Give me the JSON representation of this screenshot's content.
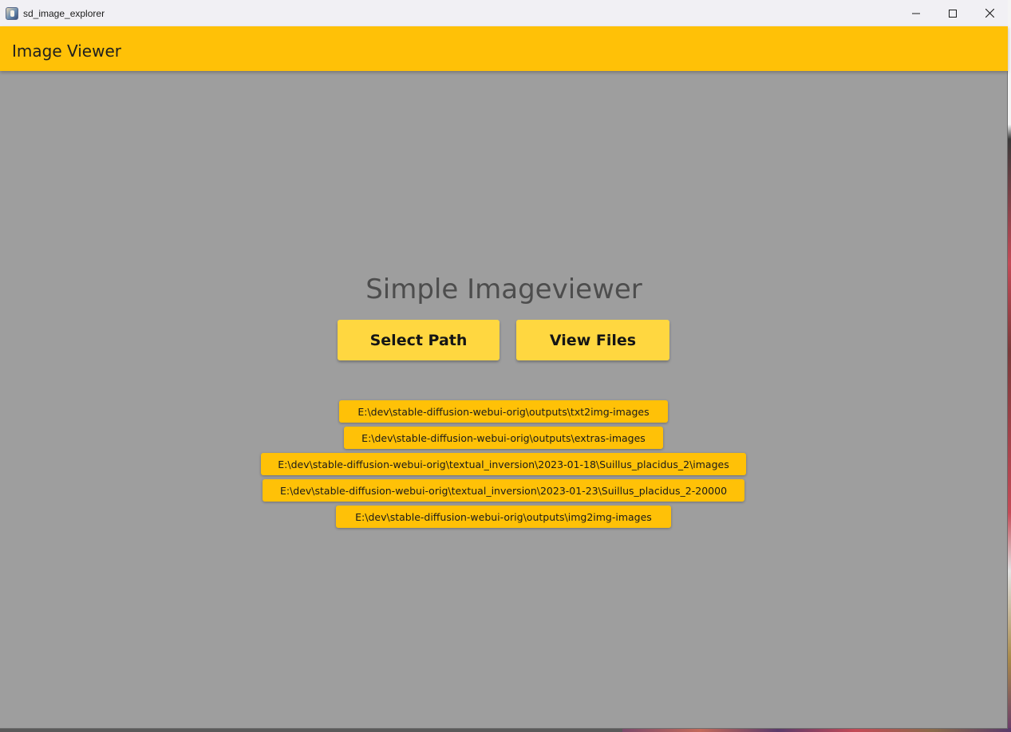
{
  "window": {
    "title": "sd_image_explorer",
    "app_icon": "app-icon",
    "controls": {
      "minimize_icon": "minimize-icon",
      "maximize_icon": "maximize-icon",
      "close_icon": "close-icon"
    }
  },
  "appbar": {
    "title": "Image Viewer",
    "color": "#ffc107"
  },
  "main": {
    "heading": "Simple Imageviewer",
    "select_path_label": "Select Path",
    "view_files_label": "View Files",
    "button_color": "#ffd740"
  },
  "recent_paths": [
    "E:\\dev\\stable-diffusion-webui-orig\\outputs\\txt2img-images",
    "E:\\dev\\stable-diffusion-webui-orig\\outputs\\extras-images",
    "E:\\dev\\stable-diffusion-webui-orig\\textual_inversion\\2023-01-18\\Suillus_placidus_2\\images",
    "E:\\dev\\stable-diffusion-webui-orig\\textual_inversion\\2023-01-23\\Suillus_placidus_2-20000",
    "E:\\dev\\stable-diffusion-webui-orig\\outputs\\img2img-images"
  ],
  "colors": {
    "background": "#9e9e9e",
    "heading_text": "#4d4d4d"
  }
}
